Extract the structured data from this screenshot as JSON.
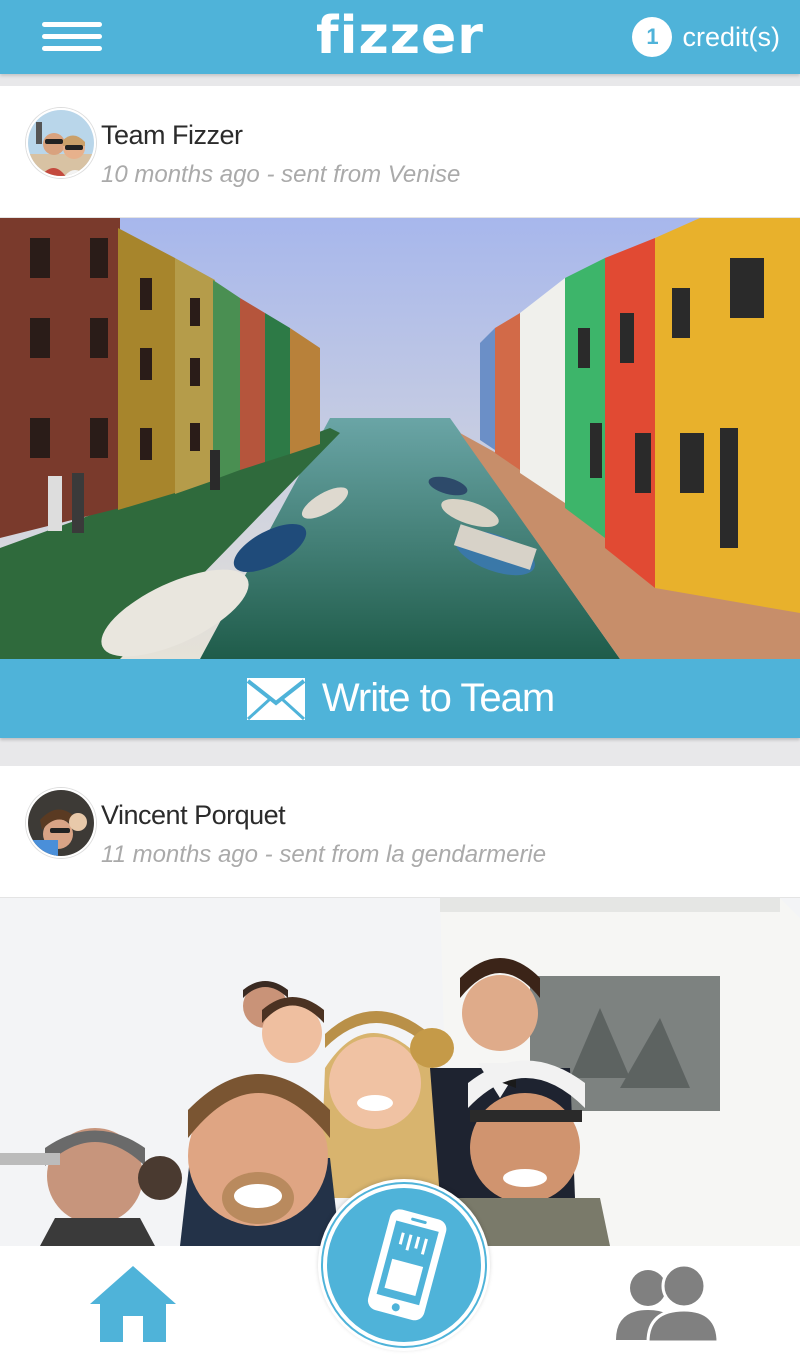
{
  "header": {
    "app_name": "fizzer",
    "credit_count": "1",
    "credit_label": "credit(s)",
    "menu_icon": "hamburger-menu-icon"
  },
  "posts": [
    {
      "author": "Team Fizzer",
      "meta": "10 months ago - sent from Venise",
      "photo_desc_icon": "venice-canal-photo",
      "action_label": "Write to Team",
      "action_icon": "envelope-icon"
    },
    {
      "author": "Vincent Porquet",
      "meta": "11 months ago - sent from la gendarmerie",
      "photo_desc_icon": "group-selfie-photo"
    }
  ],
  "nav": {
    "home_icon": "home-icon",
    "center_icon": "phone-card-icon",
    "friends_icon": "friends-icon"
  },
  "colors": {
    "brand": "#4fb3d9",
    "nav_icon_active": "#4fb3d9",
    "nav_icon_inactive": "#808080"
  }
}
